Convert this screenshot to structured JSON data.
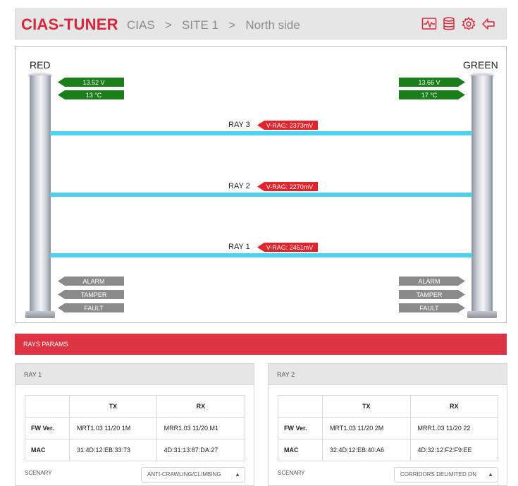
{
  "header": {
    "brand": "CIAS-TUNER",
    "breadcrumb": [
      "CIAS",
      ">",
      "SITE 1",
      ">",
      "North side"
    ],
    "icons": [
      "monitor-icon",
      "database-icon",
      "gear-icon",
      "back-arrow-icon"
    ]
  },
  "scene": {
    "left_pole": {
      "label": "RED",
      "voltage": "13.52 V",
      "temperature": "13 °C",
      "statuses": [
        "ALARM",
        "TAMPER",
        "FAULT"
      ]
    },
    "right_pole": {
      "label": "GREEN",
      "voltage": "13.66 V",
      "temperature": "17 °C",
      "statuses": [
        "ALARM",
        "TAMPER",
        "FAULT"
      ]
    },
    "rays": [
      {
        "label": "RAY 3",
        "vrag": "V-RAG: 2373mV"
      },
      {
        "label": "RAY 2",
        "vrag": "V-RAG: 2270mV"
      },
      {
        "label": "RAY 1",
        "vrag": "V-RAG: 2451mV"
      }
    ]
  },
  "params": {
    "title": "RAYS PARAMS",
    "panels": [
      {
        "title": "RAY 1",
        "col_tx": "TX",
        "col_rx": "RX",
        "fw_label": "FW Ver.",
        "fw_tx": "MRT1.03 11/20 1M",
        "fw_rx": "MRR1.03 11/20 M1",
        "mac_label": "MAC",
        "mac_tx": "31:4D:12:EB:33:73",
        "mac_rx": "4D:31:13:87:DA:27",
        "scenary_label": "SCENARY",
        "scenary_value": "ANTI-CRAWLING/CLIMBING"
      },
      {
        "title": "RAY 2",
        "col_tx": "TX",
        "col_rx": "RX",
        "fw_label": "FW Ver.",
        "fw_tx": "MRT1.03 11/20 2M",
        "fw_rx": "MRR1.03 11/20 22",
        "mac_label": "MAC",
        "mac_tx": "32:4D:12:EB:40:A6",
        "mac_rx": "4D:32:12:F2:F9:EE",
        "scenary_label": "SCENARY",
        "scenary_value": "CORRIDORS DELIMITED ON"
      }
    ]
  },
  "colors": {
    "brand_red": "#d9263a",
    "ok_green": "#1a7f1a",
    "alert_red": "#e3232b",
    "ray_cyan": "#4ad3f0",
    "status_grey": "#8a8a8a"
  }
}
